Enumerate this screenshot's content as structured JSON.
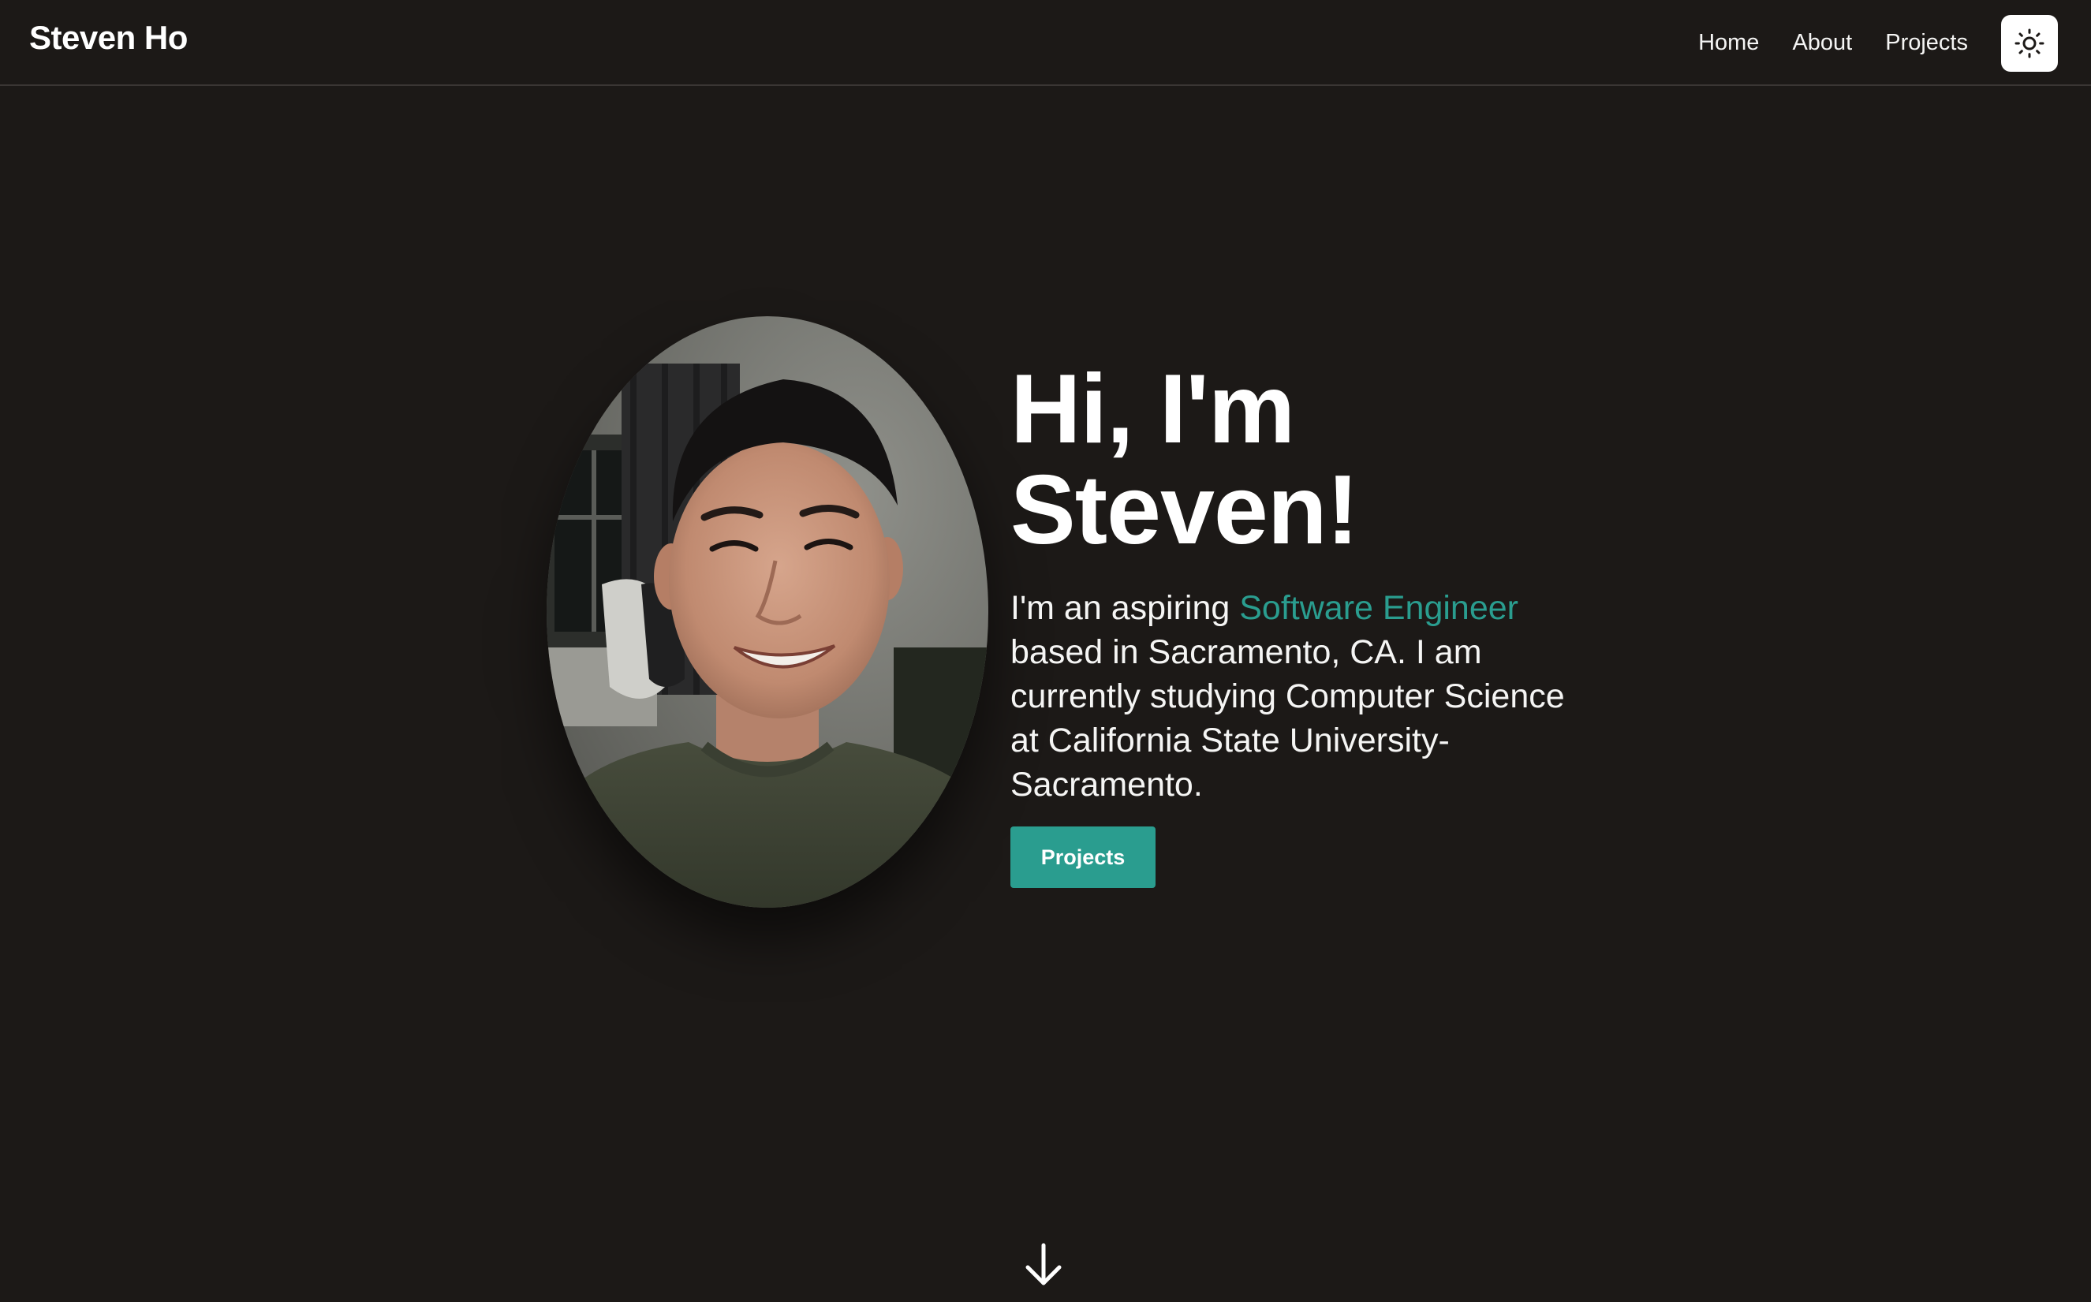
{
  "navbar": {
    "brand": "Steven Ho",
    "links": [
      {
        "label": "Home"
      },
      {
        "label": "About"
      },
      {
        "label": "Projects"
      }
    ],
    "theme_toggle_icon": "sun-icon"
  },
  "hero": {
    "title_line1": "Hi, I'm",
    "title_line2": "Steven!",
    "desc_prefix": "I'm an aspiring ",
    "desc_highlight": "Software Engineer",
    "desc_suffix": " based in Sacramento, CA. I am currently studying Computer Science at California State University-Sacramento.",
    "cta_label": "Projects",
    "scroll_icon": "arrow-down-icon"
  },
  "colors": {
    "background": "#1c1917",
    "accent": "#2a9d8f",
    "text": "#ffffff"
  }
}
